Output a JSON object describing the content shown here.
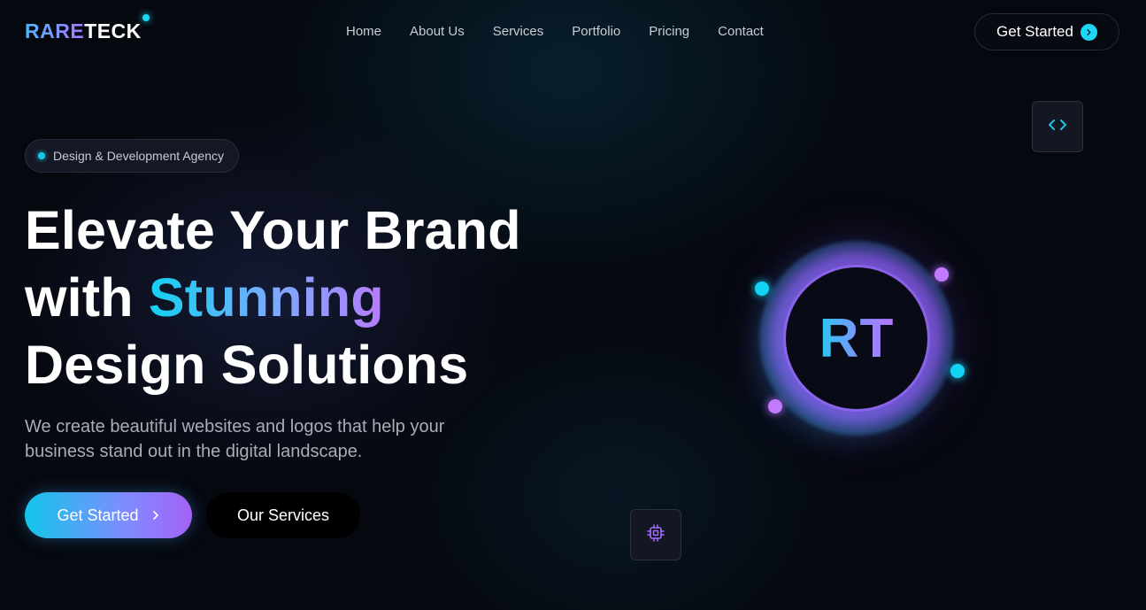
{
  "brand": {
    "part1": "RARE",
    "part2": "TECK"
  },
  "nav": {
    "items": [
      {
        "label": "Home"
      },
      {
        "label": "About Us"
      },
      {
        "label": "Services"
      },
      {
        "label": "Portfolio"
      },
      {
        "label": "Pricing"
      },
      {
        "label": "Contact"
      }
    ],
    "cta_label": "Get Started"
  },
  "hero": {
    "badge": "Design & Development Agency",
    "headline_line1": "Elevate Your Brand",
    "headline_line2_prefix": "with ",
    "headline_line2_highlight": "Stunning",
    "headline_line3": "Design Solutions",
    "subtext": "We create beautiful websites and logos that help your business stand out in the digital landscape.",
    "primary_button": "Get Started",
    "secondary_button": "Our Services"
  },
  "emblem": {
    "initials": "RT"
  },
  "icons": {
    "code_tile": "code-icon",
    "chip_tile": "chip-icon",
    "cta_chevron": "chevron-right-icon"
  },
  "colors": {
    "accent_cyan": "#12d3f3",
    "accent_violet": "#a461f5",
    "background": "#06080f"
  }
}
